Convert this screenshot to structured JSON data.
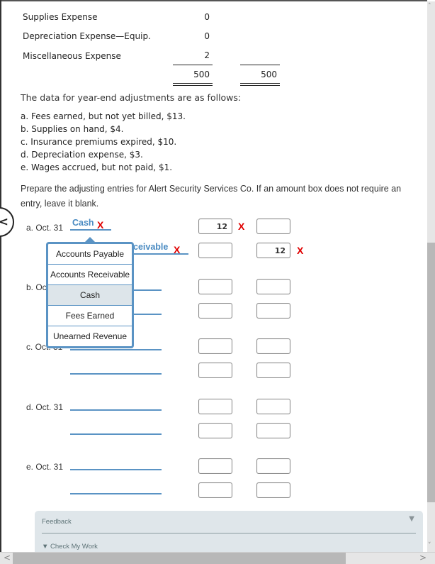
{
  "trial_balance": {
    "rows": [
      {
        "account": "Supplies Expense",
        "debit": "0"
      },
      {
        "account": "Depreciation Expense—Equip.",
        "debit": "0"
      },
      {
        "account": "Miscellaneous Expense",
        "debit": "2"
      }
    ],
    "totals": {
      "debit": "500",
      "credit": "500"
    }
  },
  "intro": "The data for year-end adjustments are as follows:",
  "adjustments": [
    "a.  Fees earned, but not yet billed, $13.",
    "b.  Supplies on hand, $4.",
    "c.  Insurance premiums expired, $10.",
    "d.  Depreciation expense, $3.",
    "e.  Wages accrued, but not paid, $1."
  ],
  "instructions": "Prepare the adjusting entries for Alert Security Services Co. If an amount box does not require an entry, leave it blank.",
  "entries": [
    {
      "label": "a. Oct. 31",
      "line1": {
        "account": "Cash",
        "status": "incorrect",
        "debit": "12",
        "debit_status": "incorrect",
        "credit": ""
      },
      "line2": {
        "account": "Accounts Receivable",
        "visible_text": "ceivable",
        "status": "incorrect",
        "debit": "",
        "credit": "12",
        "credit_status": "incorrect"
      }
    },
    {
      "label": "b. Oct. 31",
      "label_visible": "b. Oc",
      "line1": {
        "account": "",
        "debit": "",
        "credit": ""
      },
      "line2": {
        "account": "",
        "debit": "",
        "credit": ""
      }
    },
    {
      "label": "c. Oct. 31",
      "label_visible": "c. Oct. 31",
      "line1": {
        "account": "",
        "debit": "",
        "credit": ""
      },
      "line2": {
        "account": "",
        "debit": "",
        "credit": ""
      }
    },
    {
      "label": "d. Oct. 31",
      "line1": {
        "account": "",
        "debit": "",
        "credit": ""
      },
      "line2": {
        "account": "",
        "debit": "",
        "credit": ""
      }
    },
    {
      "label": "e. Oct. 31",
      "line1": {
        "account": "",
        "debit": "",
        "credit": ""
      },
      "line2": {
        "account": "",
        "debit": "",
        "credit": ""
      }
    }
  ],
  "incorrect_mark": "X",
  "dropdown": {
    "options": [
      "Accounts Payable",
      "Accounts Receivable",
      "Cash",
      "Fees Earned",
      "Unearned Revenue"
    ],
    "selected": "Cash"
  },
  "feedback": {
    "title": "Feedback",
    "toggle_icon": "▼",
    "check_my_work": "▼ Check My Work"
  },
  "nav": {
    "previous_icon": "<"
  },
  "scrollbars": {
    "up": "˄",
    "down": "˅",
    "left": "<",
    "right": ">"
  },
  "colors": {
    "accent": "#5a93c4",
    "error": "#e00000",
    "feedback_bg": "#dfe6ea",
    "selected_option_bg": "#dde5ea"
  }
}
